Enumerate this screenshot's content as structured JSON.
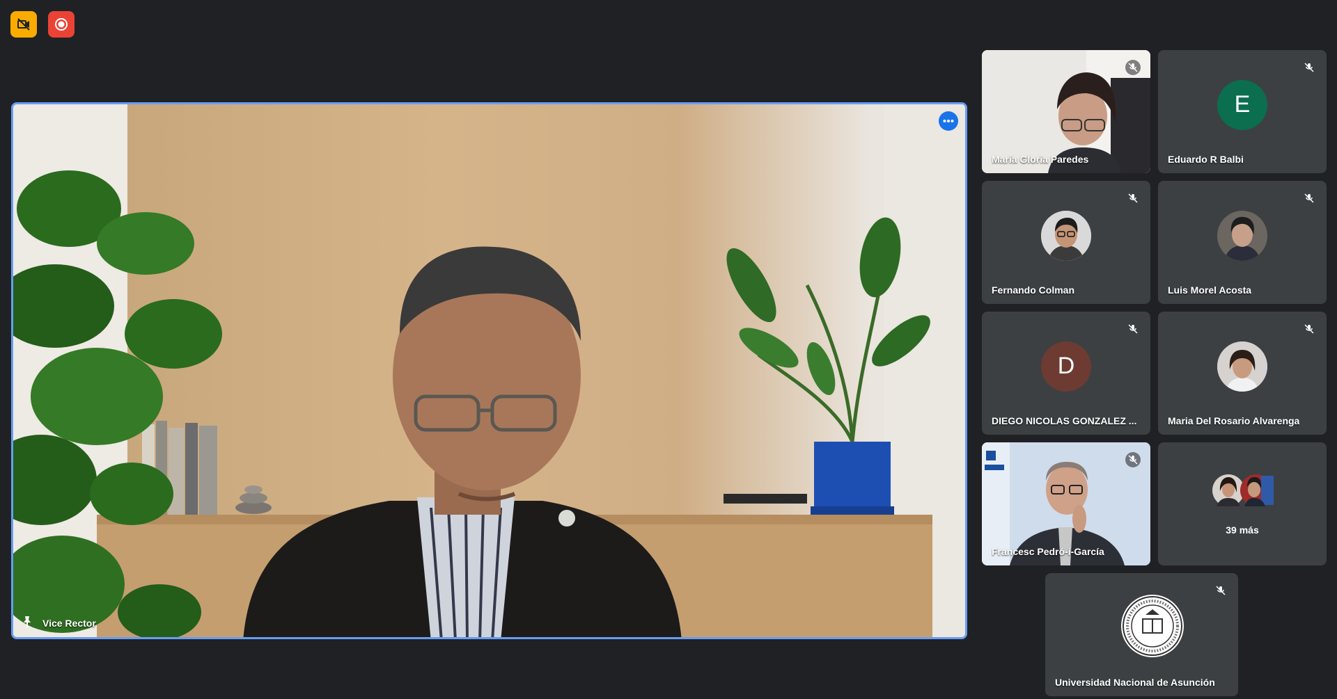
{
  "main": {
    "speaker_name": "Vice Rector"
  },
  "tiles": [
    {
      "name": "María Gloria Paredes"
    },
    {
      "name": "Eduardo R Balbi",
      "initial": "E",
      "color": "#0b6e4f"
    },
    {
      "name": "Fernando Colman"
    },
    {
      "name": "Luis Morel Acosta"
    },
    {
      "name": "DIEGO NICOLAS GONZALEZ ...",
      "initial": "D",
      "color": "#6d3b32"
    },
    {
      "name": "Maria Del Rosario Alvarenga"
    },
    {
      "name": "Francesc Pedró-i-García"
    },
    {
      "more_label": "39 más"
    },
    {
      "name": "Universidad Nacional de Asunción"
    }
  ],
  "colors": {
    "accent": "#669df6",
    "record": "#ea4335",
    "warning": "#f9ab00",
    "tile_bg": "#3c4043",
    "background": "#202124"
  }
}
